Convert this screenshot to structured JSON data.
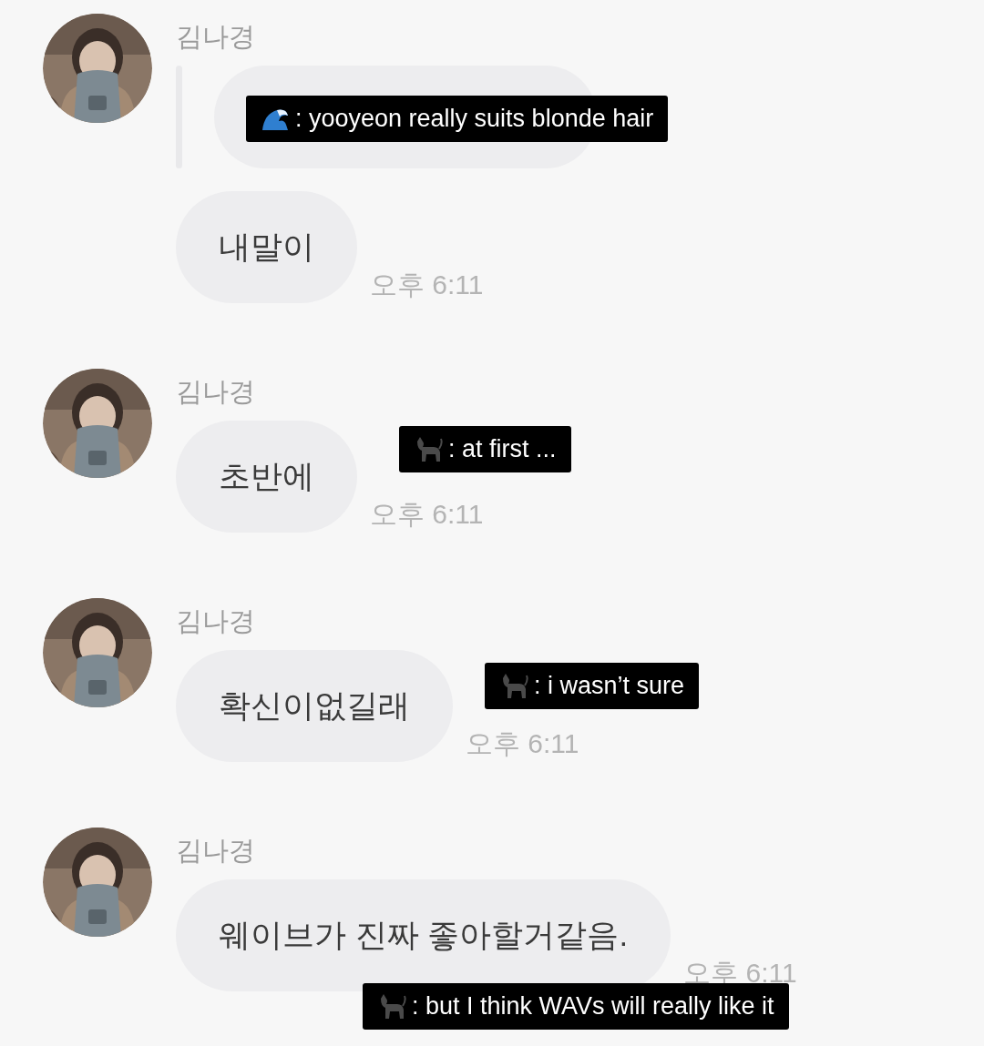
{
  "messages": [
    {
      "sender": "김나경",
      "quoted": true,
      "text": "내말이",
      "time": "오후 6:11",
      "caption": {
        "kind": "wave",
        "text": ": yooyeon really suits blonde hair"
      }
    },
    {
      "sender": "김나경",
      "quoted": false,
      "text": "초반에",
      "time": "오후 6:11",
      "caption": {
        "kind": "cat",
        "text": ": at first ..."
      }
    },
    {
      "sender": "김나경",
      "quoted": false,
      "text": "확신이없길래",
      "time": "오후 6:11",
      "caption": {
        "kind": "cat",
        "text": ": i wasn’t sure"
      }
    },
    {
      "sender": "김나경",
      "quoted": false,
      "text": "웨이브가 진짜 좋아할거같음.",
      "time": "오후 6:11",
      "caption": {
        "kind": "cat",
        "text": ": but I think WAVs will really like it"
      }
    }
  ]
}
